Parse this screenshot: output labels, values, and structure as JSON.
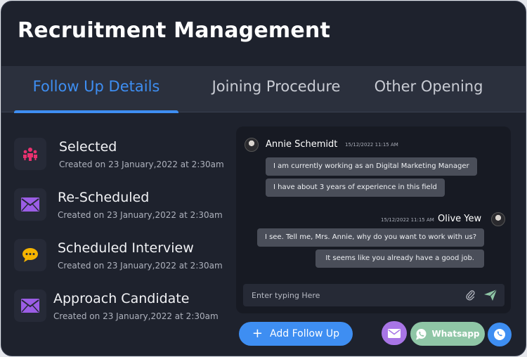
{
  "header": {
    "title": "Recruitment Management"
  },
  "tabs": [
    {
      "label": "Follow Up Details",
      "active": true
    },
    {
      "label": "Joining Procedure",
      "active": false
    },
    {
      "label": "Other Opening",
      "active": false
    }
  ],
  "statuses": [
    {
      "title": "Selected",
      "subtitle": "Created on 23 January,2022 at 2:30am",
      "icon": "team-icon",
      "color": "#e8316f"
    },
    {
      "title": "Re-Scheduled",
      "subtitle": "Created on 23 January,2022 at 2:30am",
      "icon": "envelope-icon",
      "color": "#9b5de5"
    },
    {
      "title": "Scheduled Interview",
      "subtitle": "Created on 23 January,2022 at 2:30am",
      "icon": "chat-bubble-icon",
      "color": "#f5b400"
    },
    {
      "title": "Approach Candidate",
      "subtitle": "Created on 23 January,2022 at 2:30am",
      "icon": "envelope-icon",
      "color": "#9b5de5"
    }
  ],
  "chat": {
    "incoming": {
      "name": "Annie Schemidt",
      "time": "15/12/2022 11:15 AM",
      "messages": [
        "I am currently working as an Digital Marketing Manager",
        "I have about 3 years of experience in this field"
      ]
    },
    "outgoing": {
      "name": "Olive Yew",
      "time": "15/12/2022 11:15 AM",
      "messages": [
        "I see. Tell me, Mrs. Annie, why do you want to work with us?",
        "It seems like you already have a good job."
      ]
    },
    "input_placeholder": "Enter typing Here"
  },
  "actions": {
    "add_follow_up": "Add Follow Up",
    "whatsapp": "Whatsapp"
  },
  "colors": {
    "accent": "#3e8ef2",
    "background": "#1e222d",
    "mail_button": "#a875e6",
    "whatsapp_button": "#8fc6a6"
  }
}
